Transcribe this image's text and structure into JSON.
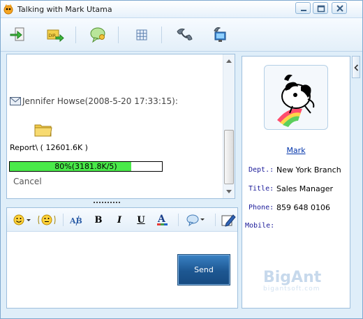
{
  "window": {
    "title": "Talking with Mark Utama",
    "controls": [
      "minimize",
      "maximize",
      "close"
    ]
  },
  "toolbar": {
    "buttons": [
      {
        "name": "send-file-button",
        "icon": "send-file-icon"
      },
      {
        "name": "send-folder-button",
        "icon": "folder-arrow-icon",
        "badge": "DIR"
      },
      {
        "name": "chat-bubble-button",
        "icon": "chat-bubble-icon"
      },
      {
        "name": "grid-button",
        "icon": "grid-icon"
      },
      {
        "name": "phone-button",
        "icon": "phone-icon"
      },
      {
        "name": "remote-desktop-button",
        "icon": "remote-desktop-icon"
      }
    ]
  },
  "conversation": {
    "sender_line": "Jennifer Howse(2008-5-20 17:33:15):",
    "file_name": "Report\\ ( 12601.6K )",
    "progress_label": "80%(3181.8K/5)",
    "progress_value": 0.8,
    "cancel_label": "Cancel"
  },
  "format_bar": {
    "bold": "B",
    "italic": "I",
    "underline": "U",
    "font_color": "A",
    "font_label": "AB"
  },
  "input": {
    "send_label": "Send"
  },
  "contact": {
    "name": "Mark",
    "fields": [
      {
        "label": "Dept.:",
        "value": "New York Branch"
      },
      {
        "label": "Title:",
        "value": "Sales Manager"
      },
      {
        "label": "Phone:",
        "value": "859 648 0106"
      },
      {
        "label": "Mobile:",
        "value": ""
      }
    ],
    "watermark": "BigAnt",
    "watermark_sub": "bigantsoft.com"
  },
  "colors": {
    "progress_fill": "#4aea4a",
    "send_button": "#1d5792",
    "frame": "#dfeef9"
  }
}
